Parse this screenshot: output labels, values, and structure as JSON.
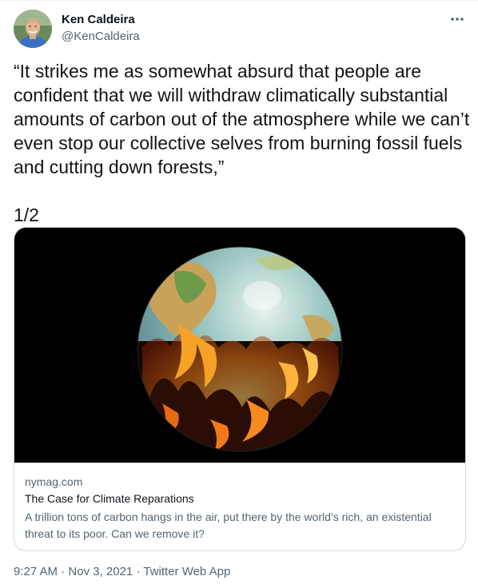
{
  "author": {
    "display_name": "Ken Caldeira",
    "handle": "@KenCaldeira"
  },
  "menu_icon": "more-horizontal-icon",
  "tweet": {
    "text": "“It strikes me as somewhat absurd that people are confident that we will withdraw climatically substantial amounts of carbon out of the atmosphere while we can’t even stop our collective selves from burning fossil fuels and cutting down forests,”\n\n1/2"
  },
  "card": {
    "domain": "nymag.com",
    "title": "The Case for Climate Reparations",
    "description": "A trillion tons of carbon hangs in the air, put there by the world’s rich, an existential threat to its poor. Can we remove it?"
  },
  "meta": {
    "time": "9:27 AM",
    "date": "Nov 3, 2021",
    "source": "Twitter Web App",
    "separator": "·"
  },
  "colors": {
    "text_primary": "#0f1419",
    "text_secondary": "#536471",
    "border": "#cfd9de"
  }
}
